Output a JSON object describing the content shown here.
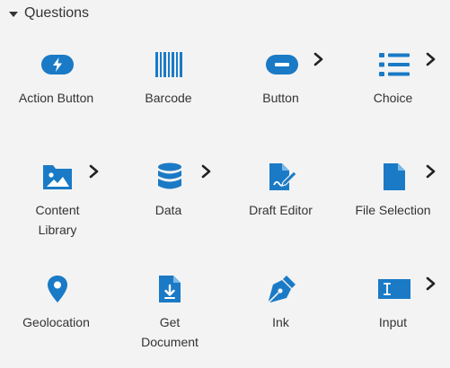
{
  "section": {
    "title": "Questions",
    "expanded": true
  },
  "accent_color": "#1a7ac6",
  "items": [
    {
      "label": "Action Button",
      "icon": "action-button-icon",
      "submenu": false
    },
    {
      "label": "Barcode",
      "icon": "barcode-icon",
      "submenu": false
    },
    {
      "label": "Button",
      "icon": "button-icon",
      "submenu": true
    },
    {
      "label": "Choice",
      "icon": "choice-list-icon",
      "submenu": true
    },
    {
      "label": "Content Library",
      "icon": "image-folder-icon",
      "submenu": true
    },
    {
      "label": "Data",
      "icon": "database-icon",
      "submenu": true
    },
    {
      "label": "Draft Editor",
      "icon": "draft-editor-icon",
      "submenu": false
    },
    {
      "label": "File Selection",
      "icon": "file-icon",
      "submenu": true
    },
    {
      "label": "Geolocation",
      "icon": "map-pin-icon",
      "submenu": false
    },
    {
      "label": "Get Document",
      "icon": "download-document-icon",
      "submenu": false
    },
    {
      "label": "Ink",
      "icon": "pen-nib-icon",
      "submenu": false
    },
    {
      "label": "Input",
      "icon": "text-input-icon",
      "submenu": true
    }
  ]
}
